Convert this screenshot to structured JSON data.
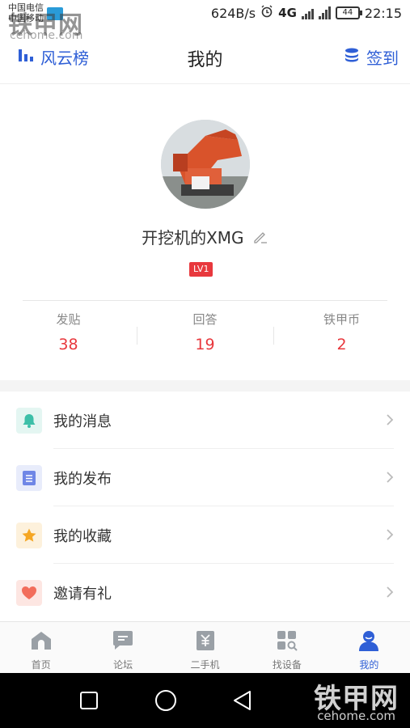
{
  "status_bar": {
    "carrier_1": "中国电信",
    "carrier_2": "中国移动",
    "net_speed": "624B/s",
    "network": "4G",
    "battery": "44",
    "time": "22:15"
  },
  "watermark": {
    "brand": "铁甲网",
    "site": "cehome.com"
  },
  "header": {
    "left_label": "风云榜",
    "title": "我的",
    "right_label": "签到"
  },
  "profile": {
    "username": "开挖机的XMG",
    "level": "LV1"
  },
  "stats": [
    {
      "label": "发贴",
      "value": "38"
    },
    {
      "label": "回答",
      "value": "19"
    },
    {
      "label": "铁甲币",
      "value": "2"
    }
  ],
  "menu": [
    {
      "label": "我的消息",
      "icon": "bell-icon",
      "icon_color": "#3dbfa8",
      "bg": "#e4f6f2"
    },
    {
      "label": "我的发布",
      "icon": "document-icon",
      "icon_color": "#6f86e6",
      "bg": "#e8ecfb"
    },
    {
      "label": "我的收藏",
      "icon": "star-icon",
      "icon_color": "#f5a623",
      "bg": "#fdf1dc"
    },
    {
      "label": "邀请有礼",
      "icon": "heart-icon",
      "icon_color": "#f26d5b",
      "bg": "#fde6e2"
    }
  ],
  "tabs": [
    {
      "label": "首页",
      "icon": "home-icon"
    },
    {
      "label": "论坛",
      "icon": "chat-icon"
    },
    {
      "label": "二手机",
      "icon": "yuan-tag-icon"
    },
    {
      "label": "找设备",
      "icon": "grid-search-icon"
    },
    {
      "label": "我的",
      "icon": "user-icon",
      "active": true
    }
  ],
  "colors": {
    "accent": "#2f5fd6",
    "stat_value": "#e8383d",
    "level_badge": "#e8383d"
  }
}
